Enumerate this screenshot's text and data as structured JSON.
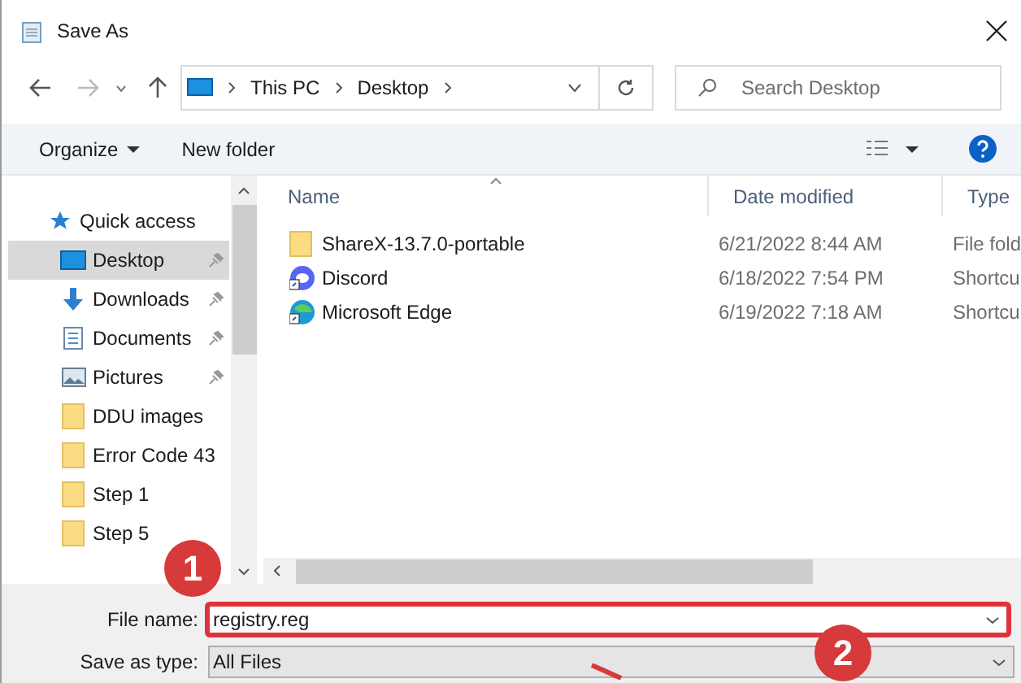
{
  "window": {
    "title": "Save As"
  },
  "address_bar": {
    "path": [
      "This PC",
      "Desktop"
    ]
  },
  "search": {
    "placeholder": "Search Desktop"
  },
  "toolbar": {
    "buttons": [
      "Organize",
      "New folder"
    ]
  },
  "sidebar": {
    "items": [
      {
        "label": "Quick access",
        "kind": "star",
        "pinned": false,
        "selected": false
      },
      {
        "label": "Desktop",
        "kind": "desktop",
        "pinned": true,
        "selected": true
      },
      {
        "label": "Downloads",
        "kind": "download",
        "pinned": true,
        "selected": false
      },
      {
        "label": "Documents",
        "kind": "document",
        "pinned": true,
        "selected": false
      },
      {
        "label": "Pictures",
        "kind": "picture",
        "pinned": true,
        "selected": false
      },
      {
        "label": "DDU images",
        "kind": "folder",
        "pinned": false,
        "selected": false
      },
      {
        "label": "Error Code 43",
        "kind": "folder",
        "pinned": false,
        "selected": false
      },
      {
        "label": "Step 1",
        "kind": "folder",
        "pinned": false,
        "selected": false
      },
      {
        "label": "Step 5",
        "kind": "folder",
        "pinned": false,
        "selected": false
      }
    ]
  },
  "table": {
    "columns": [
      "Name",
      "Date modified",
      "Type"
    ],
    "rows": [
      {
        "name": "ShareX-13.7.0-portable",
        "kind": "folder",
        "date": "6/21/2022 8:44 AM",
        "type": "File fold"
      },
      {
        "name": "Discord",
        "kind": "discord",
        "date": "6/18/2022 7:54 PM",
        "type": "Shortcu"
      },
      {
        "name": "Microsoft Edge",
        "kind": "edge",
        "date": "6/19/2022 7:18 AM",
        "type": "Shortcu"
      }
    ]
  },
  "file_name": {
    "label": "File name:",
    "value": "registry.reg"
  },
  "save_as_type": {
    "label": "Save as type:",
    "value": "All Files"
  },
  "annotations": [
    "1",
    "2"
  ]
}
